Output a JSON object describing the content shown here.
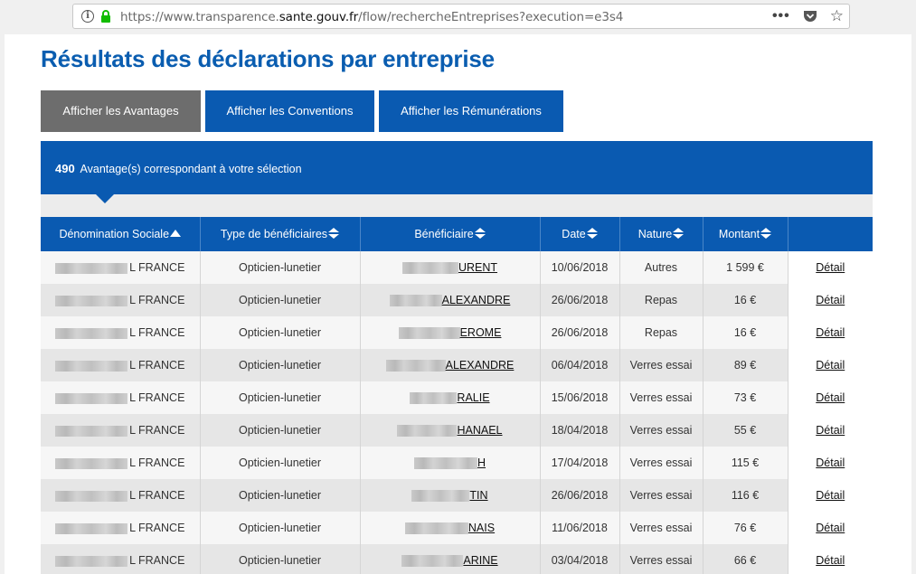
{
  "browser": {
    "url_prefix": "https://www.transparence.",
    "url_domain": "sante.gouv.fr",
    "url_suffix": "/flow/rechercheEntreprises?execution=e3s4",
    "menu_icon": "more-dots-icon",
    "pocket_icon": "pocket-icon",
    "bookmark_icon": "star-icon"
  },
  "page": {
    "title": "Résultats des déclarations par entreprise"
  },
  "tabs": [
    {
      "label": "Afficher les Avantages",
      "active": true
    },
    {
      "label": "Afficher les Conventions",
      "active": false
    },
    {
      "label": "Afficher les Rémunérations",
      "active": false
    }
  ],
  "results": {
    "count": "490",
    "text": "Avantage(s) correspondant à votre sélection"
  },
  "table": {
    "headers": [
      "Dénomination Sociale",
      "Type de bénéficiaires",
      "Bénéficiaire",
      "Date",
      "Nature",
      "Montant",
      ""
    ],
    "rows": [
      {
        "denom": "L FRANCE",
        "type": "Opticien-lunetier",
        "benef": "URENT",
        "date": "10/06/2018",
        "nature": "Autres",
        "montant": "1 599 €",
        "detail": "Détail"
      },
      {
        "denom": "L FRANCE",
        "type": "Opticien-lunetier",
        "benef": "ALEXANDRE",
        "date": "26/06/2018",
        "nature": "Repas",
        "montant": "16 €",
        "detail": "Détail"
      },
      {
        "denom": "L FRANCE",
        "type": "Opticien-lunetier",
        "benef": "EROME",
        "date": "26/06/2018",
        "nature": "Repas",
        "montant": "16 €",
        "detail": "Détail"
      },
      {
        "denom": "L FRANCE",
        "type": "Opticien-lunetier",
        "benef": "ALEXANDRE",
        "date": "06/04/2018",
        "nature": "Verres essai",
        "montant": "89 €",
        "detail": "Détail"
      },
      {
        "denom": "L FRANCE",
        "type": "Opticien-lunetier",
        "benef": "RALIE",
        "date": "15/06/2018",
        "nature": "Verres essai",
        "montant": "73 €",
        "detail": "Détail"
      },
      {
        "denom": "L FRANCE",
        "type": "Opticien-lunetier",
        "benef": "HANAEL",
        "date": "18/04/2018",
        "nature": "Verres essai",
        "montant": "55 €",
        "detail": "Détail"
      },
      {
        "denom": "L FRANCE",
        "type": "Opticien-lunetier",
        "benef": "H",
        "date": "17/04/2018",
        "nature": "Verres essai",
        "montant": "115 €",
        "detail": "Détail"
      },
      {
        "denom": "L FRANCE",
        "type": "Opticien-lunetier",
        "benef": "TIN",
        "date": "26/06/2018",
        "nature": "Verres essai",
        "montant": "116 €",
        "detail": "Détail"
      },
      {
        "denom": "L FRANCE",
        "type": "Opticien-lunetier",
        "benef": "NAIS",
        "date": "11/06/2018",
        "nature": "Verres essai",
        "montant": "76 €",
        "detail": "Détail"
      },
      {
        "denom": "L FRANCE",
        "type": "Opticien-lunetier",
        "benef": "ARINE",
        "date": "03/04/2018",
        "nature": "Verres essai",
        "montant": "66 €",
        "detail": "Détail"
      }
    ]
  },
  "colors": {
    "brand_blue": "#0a5ab1",
    "title_blue": "#0a5db0",
    "active_tab_gray": "#6d6d6d"
  }
}
